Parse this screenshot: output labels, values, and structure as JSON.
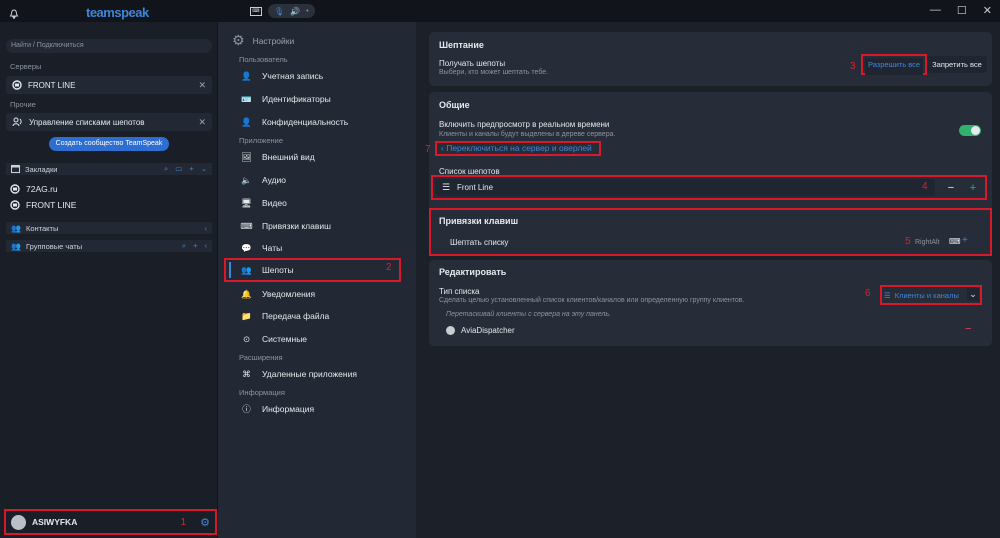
{
  "app": {
    "logo": "teamspeak"
  },
  "titlebar": {
    "minimize": "—",
    "maximize": "☐",
    "close": "✕",
    "speaker_icon": "🔊",
    "mic_icon": "🎙"
  },
  "sidebar": {
    "search_placeholder": "Найти / Подключиться",
    "servers_label": "Серверы",
    "server_tab": "FRONT LINE",
    "other_label": "Прочие",
    "other_tab": "Управление списками шепотов",
    "community_button": "Создать сообщество TeamSpeak",
    "bookmarks_label": "Закладки",
    "bookmarks": [
      "72AG.ru",
      "FRONT LINE"
    ],
    "contacts_label": "Контакты",
    "group_chats_label": "Групповые чаты",
    "user_name": "ASIWYFKA"
  },
  "nav": {
    "header": "Настройки",
    "cat_user": "Пользователь",
    "cat_app": "Приложение",
    "cat_ext": "Расширения",
    "cat_info": "Информация",
    "items": {
      "account": "Учетная запись",
      "identities": "Идентификаторы",
      "privacy": "Конфиденциальность",
      "appearance": "Внешний вид",
      "audio": "Аудио",
      "video": "Видео",
      "hotkeys": "Привязки клавиш",
      "chats": "Чаты",
      "whispers": "Шепоты",
      "notifications": "Уведомления",
      "filetransfer": "Передача файла",
      "system": "Системные",
      "remoteapps": "Удаленные приложения",
      "info": "Информация"
    }
  },
  "main": {
    "whisper": {
      "title": "Шептание",
      "receive_label": "Получать шепоты",
      "receive_sub": "Выбери, кто может шептать тебе.",
      "allow_all": "Разрешить все",
      "deny_all": "Запретить все"
    },
    "general": {
      "title": "Общие",
      "realtime_label": "Включить предпросмотр в реальном времени",
      "realtime_sub": "Клиенты и каналы будут выделены в дереве сервера.",
      "switch_link": "Переключиться на сервер и оверлей",
      "list_label": "Список шепотов",
      "list_value": "Front Line"
    },
    "hotkeys": {
      "title": "Привязки клавиш",
      "whisper_list": "Шептать списку",
      "key": "RightAlt"
    },
    "edit": {
      "title": "Редактировать",
      "type_label": "Тип списка",
      "type_sub": "Сделать целью установленный список клиентов/каналов или определенную группу клиентов.",
      "type_value": "Клиенты и каналы",
      "drag_hint": "Перетаскивай клиенты с сервера на эту панель.",
      "client": "AviaDispatcher"
    }
  },
  "annotations": {
    "n1": "1",
    "n2": "2",
    "n3": "3",
    "n4": "4",
    "n5": "5",
    "n6": "6",
    "n7": "7"
  },
  "colors": {
    "accent": "#3f86d8",
    "highlight": "#d8192b",
    "toggle_on": "#2fb36d"
  }
}
